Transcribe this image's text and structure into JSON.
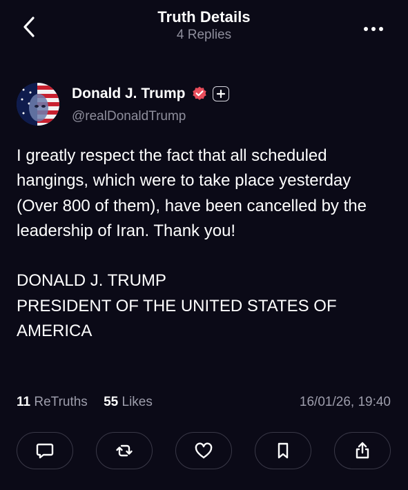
{
  "header": {
    "title": "Truth Details",
    "subtitle": "4 Replies"
  },
  "author": {
    "name": "Donald J. Trump",
    "handle": "@realDonaldTrump"
  },
  "post": {
    "paragraph": "I greatly respect the fact that all scheduled hangings, which were to take place yesterday (Over 800 of them), have been cancelled by the leadership of Iran. Thank you!",
    "signature_line1": "DONALD J. TRUMP",
    "signature_line2": "PRESIDENT OF THE UNITED STATES OF AMERICA"
  },
  "stats": {
    "retruths_count": "11",
    "retruths_label": "ReTruths",
    "likes_count": "55",
    "likes_label": "Likes",
    "timestamp": "16/01/26, 19:40"
  },
  "colors": {
    "background": "#0b0a17",
    "verified": "#e84d5b",
    "muted": "#8e8e9c"
  },
  "icons": {
    "back": "chevron-left-icon",
    "more": "more-icon",
    "verified": "verified-badge-icon",
    "follow": "plus-icon",
    "reply": "comment-icon",
    "retruth": "repost-icon",
    "like": "heart-icon",
    "bookmark": "bookmark-icon",
    "share": "share-icon"
  }
}
